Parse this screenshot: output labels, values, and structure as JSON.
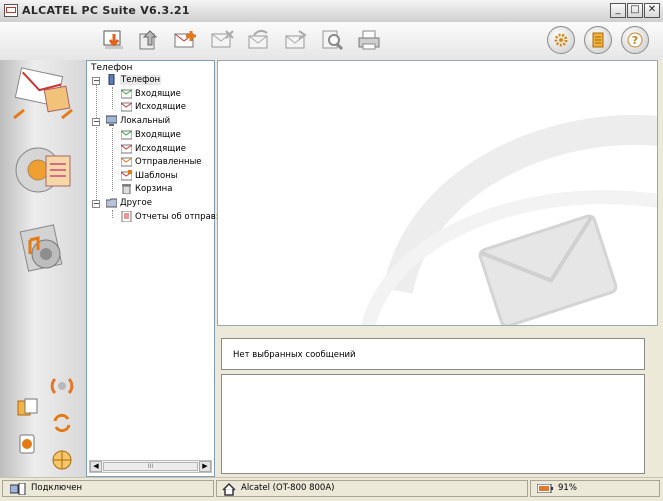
{
  "window": {
    "title": "ALCATEL PC Suite V6.3.21",
    "controls": {
      "minimize": "_",
      "maximize": "□",
      "close": "✕"
    }
  },
  "toolbar": {
    "icons": [
      "receive-icon",
      "send-icon",
      "new-message-icon",
      "delete-message-icon",
      "reply-icon",
      "forward-icon",
      "search-message-icon",
      "print-icon"
    ],
    "right_icons": [
      "settings-icon",
      "notes-icon",
      "help-icon"
    ],
    "help_glyph": "?"
  },
  "sidebar": {
    "modules": [
      "messages-module-icon",
      "contacts-module-icon",
      "multimedia-module-icon"
    ],
    "tools": [
      "connection-icon",
      "backup-icon",
      "sync-icon",
      "phone-settings-icon",
      "internet-icon"
    ]
  },
  "tree": {
    "root_label": "Телефон",
    "phone": {
      "label": "Телефон",
      "children": [
        "Входящие",
        "Исходящие"
      ]
    },
    "local": {
      "label": "Локальный",
      "children": [
        "Входящие",
        "Исходящие",
        "Отправленные",
        "Шаблоны",
        "Корзина"
      ]
    },
    "other": {
      "label": "Другое",
      "children": [
        "Отчеты об отправ:"
      ]
    },
    "scroll_thumb_glyph": "III"
  },
  "main": {
    "info_text": "Нет выбранных сообщений"
  },
  "status": {
    "connection": "Подключен",
    "device": "Alcatel (OT-800 800A)",
    "battery": "91%"
  },
  "colors": {
    "accent_red": "#d94a1e",
    "accent_orange": "#f39a1b",
    "tree_border": "#7f9db9"
  }
}
